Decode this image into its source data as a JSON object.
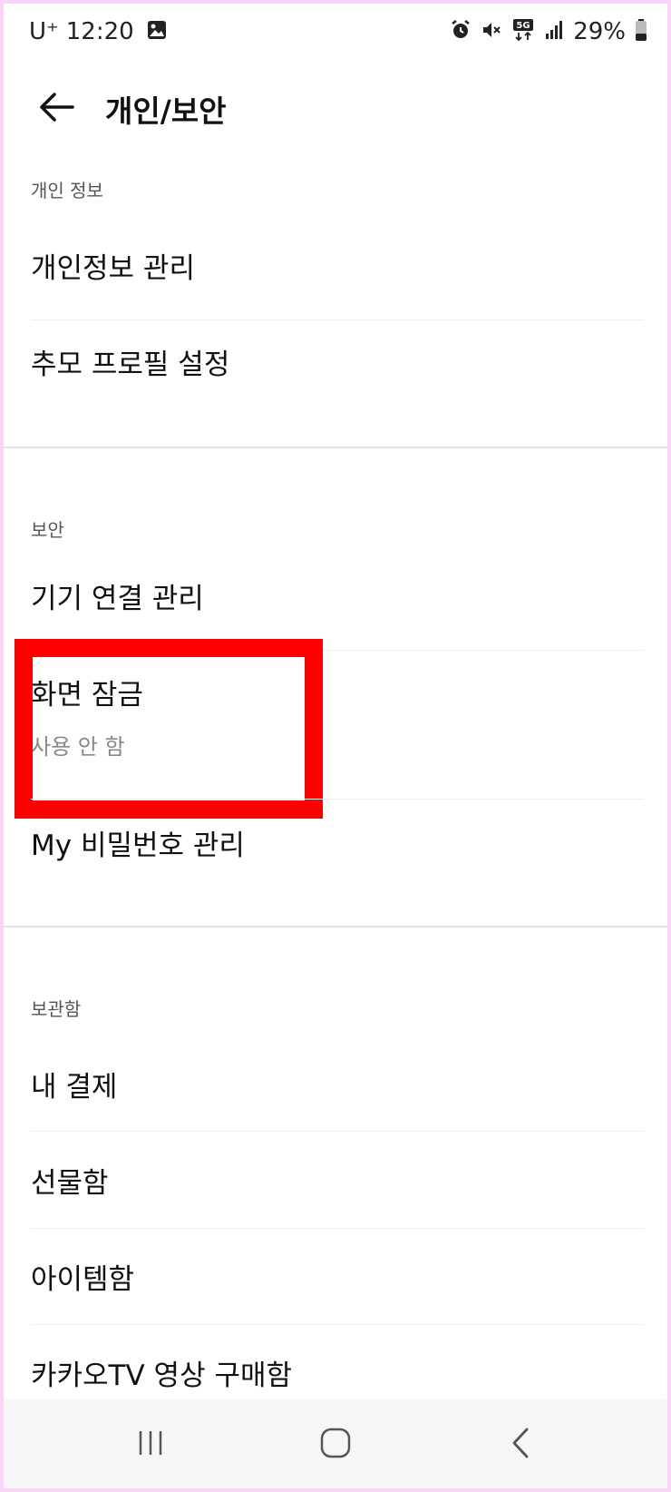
{
  "status_bar": {
    "carrier": "U⁺",
    "time": "12:20",
    "battery": "29%",
    "icons": [
      "image-icon",
      "alarm-icon",
      "mute-icon",
      "5g-icon",
      "signal-icon",
      "battery-icon"
    ]
  },
  "header": {
    "back_icon": "arrow-left-icon",
    "title": "개인/보안"
  },
  "sections": [
    {
      "label": "개인 정보",
      "items": [
        {
          "title": "개인정보 관리"
        },
        {
          "title": "추모 프로필 설정"
        }
      ]
    },
    {
      "label": "보안",
      "items": [
        {
          "title": "기기 연결 관리"
        },
        {
          "title": "화면 잠금",
          "subtitle": "사용 안 함"
        },
        {
          "title": "My 비밀번호 관리"
        }
      ]
    },
    {
      "label": "보관함",
      "items": [
        {
          "title": "내 결제"
        },
        {
          "title": "선물함"
        },
        {
          "title": "아이템함"
        },
        {
          "title": "카카오TV 영상 구매함"
        }
      ]
    }
  ],
  "highlight": {
    "color": "#ff0000",
    "target": "화면 잠금"
  },
  "nav_bar": {
    "buttons": [
      "recents-icon",
      "home-icon",
      "back-icon"
    ]
  }
}
